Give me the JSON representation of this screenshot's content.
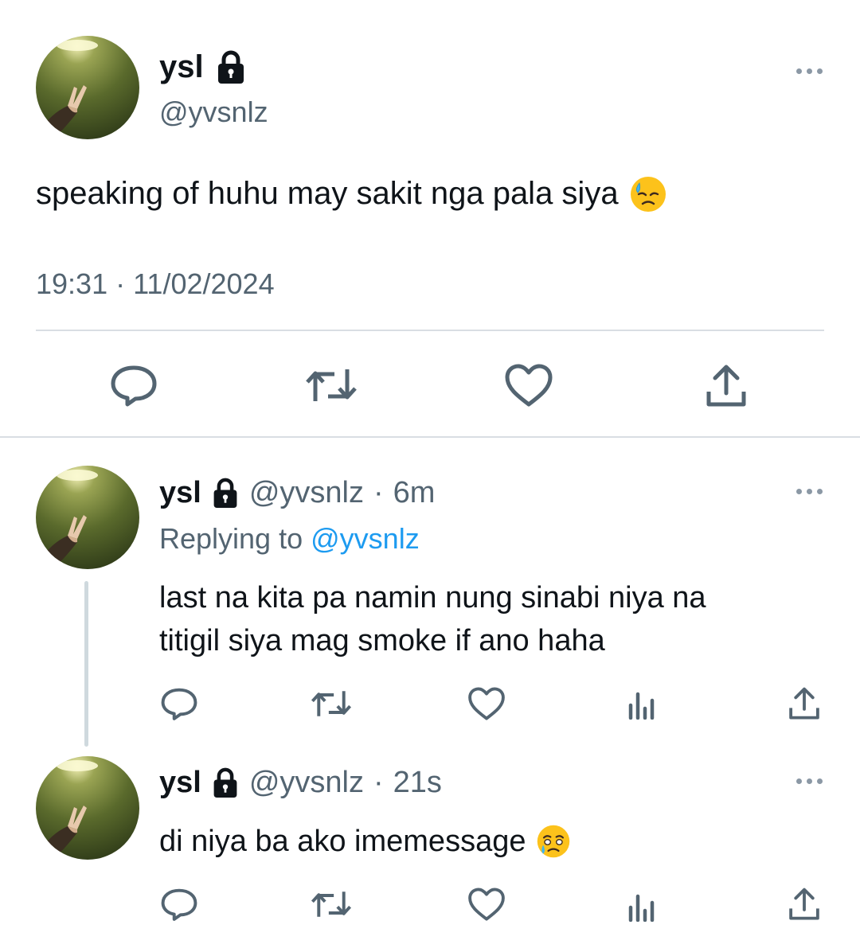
{
  "main_tweet": {
    "display_name": "ysl",
    "handle": "@yvsnlz",
    "text": "speaking of huhu may sakit nga pala siya",
    "timestamp": "19:31 · 11/02/2024",
    "emoji": "downcast-face-with-sweat"
  },
  "replies": [
    {
      "display_name": "ysl",
      "handle": "@yvsnlz",
      "separator": "·",
      "time": "6m",
      "replying_prefix": "Replying to",
      "replying_to": "@yvsnlz",
      "text_line1": "last na kita pa namin nung sinabi niya na",
      "text_line2": "titigil siya mag smoke if ano haha"
    },
    {
      "display_name": "ysl",
      "handle": "@yvsnlz",
      "separator": "·",
      "time": "21s",
      "text": "di niya ba ako imemessage",
      "emoji": "face-holding-back-tears"
    }
  ],
  "icons": {
    "reply": "reply-icon",
    "retweet": "retweet-icon",
    "like": "like-icon",
    "views": "views-icon",
    "share": "share-icon",
    "lock": "lock-icon",
    "more": "more-icon"
  },
  "colors": {
    "text": "#0f1419",
    "secondary": "#536471",
    "link": "#1d9bf0",
    "divider": "#d9dee3"
  }
}
